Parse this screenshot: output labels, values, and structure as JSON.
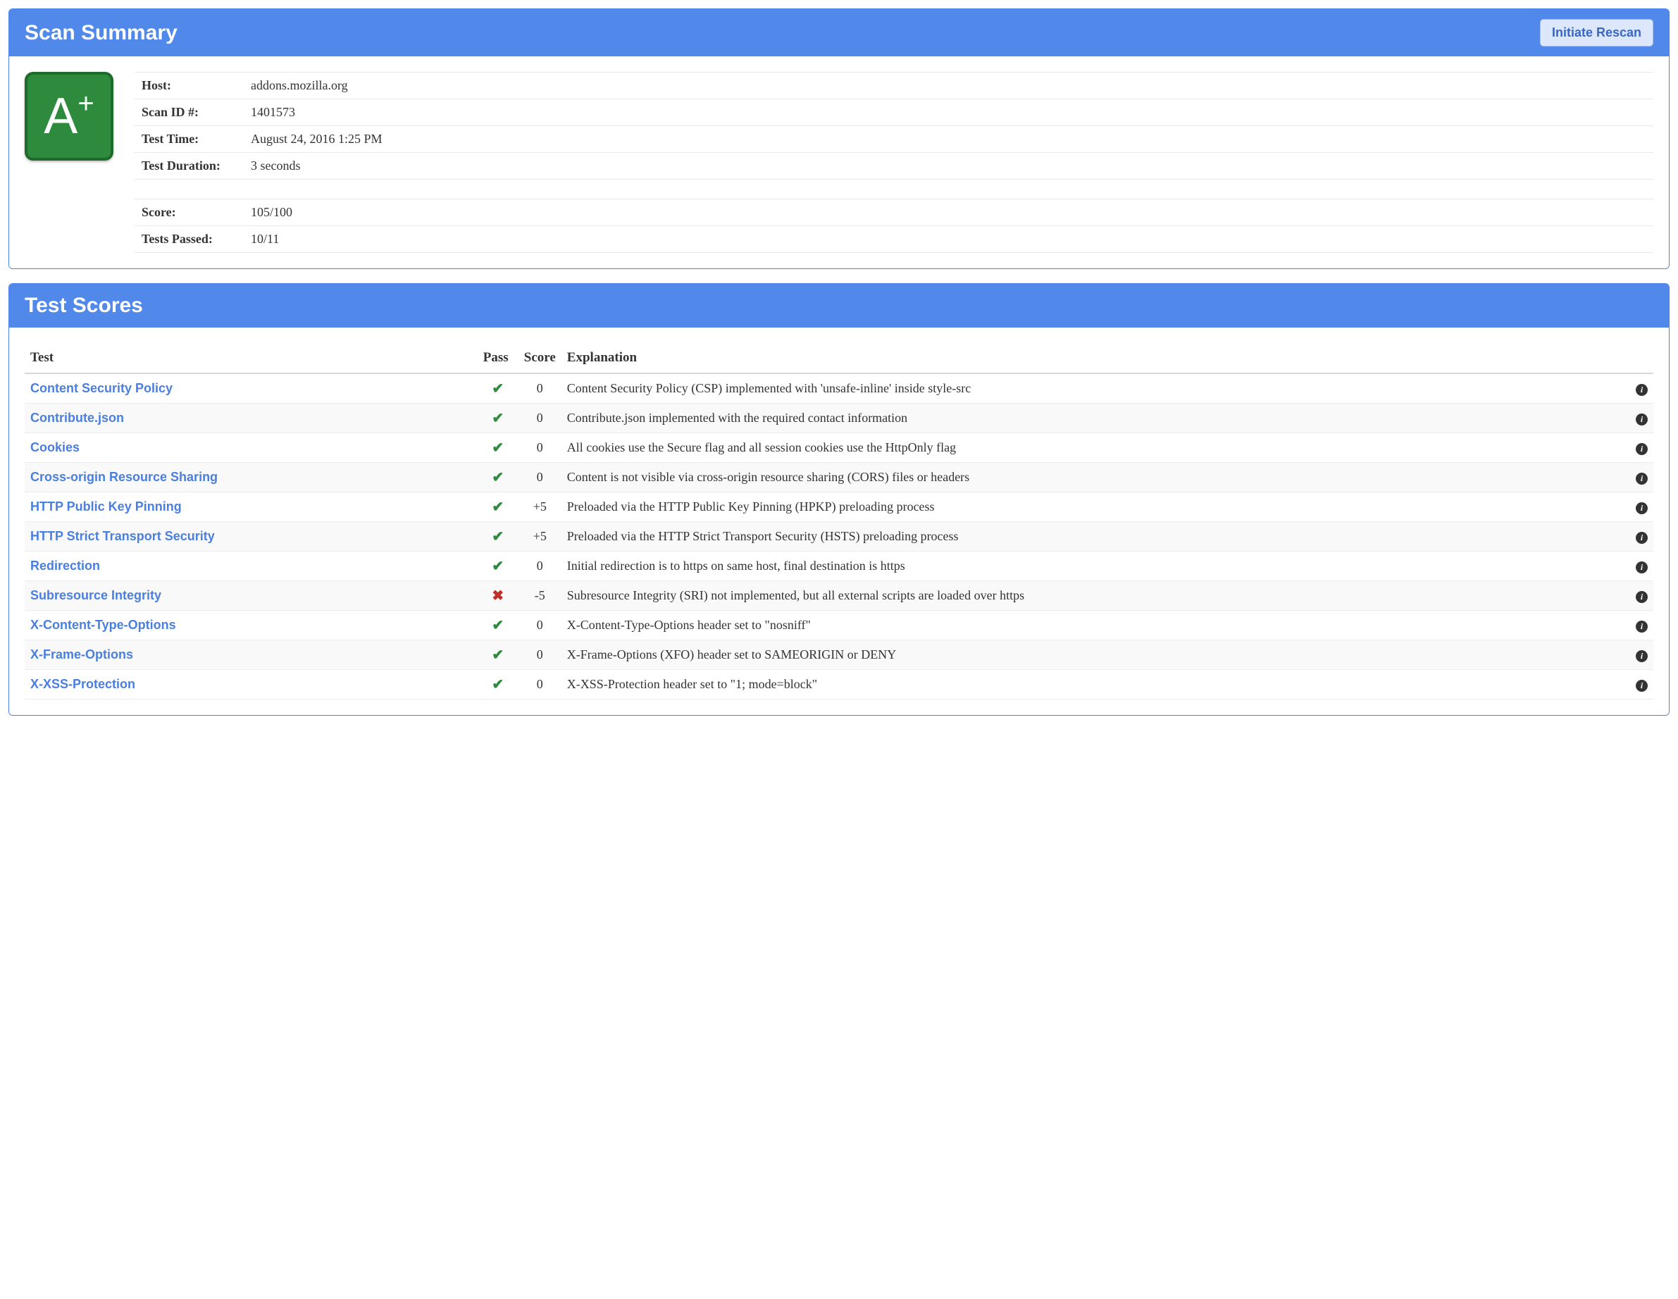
{
  "summary": {
    "panel_title": "Scan Summary",
    "rescan_label": "Initiate Rescan",
    "grade_letter": "A",
    "grade_suffix": "+",
    "labels": {
      "host": "Host:",
      "scan_id": "Scan ID #:",
      "test_time": "Test Time:",
      "test_duration": "Test Duration:",
      "score": "Score:",
      "tests_passed": "Tests Passed:"
    },
    "values": {
      "host": "addons.mozilla.org",
      "scan_id": "1401573",
      "test_time": "August 24, 2016 1:25 PM",
      "test_duration": "3 seconds",
      "score": "105/100",
      "tests_passed": "10/11"
    }
  },
  "scores": {
    "panel_title": "Test Scores",
    "columns": {
      "test": "Test",
      "pass": "Pass",
      "score": "Score",
      "explanation": "Explanation"
    },
    "rows": [
      {
        "test": "Content Security Policy",
        "pass": true,
        "score": "0",
        "explanation": "Content Security Policy (CSP) implemented with 'unsafe-inline' inside style-src"
      },
      {
        "test": "Contribute.json",
        "pass": true,
        "score": "0",
        "explanation": "Contribute.json implemented with the required contact information"
      },
      {
        "test": "Cookies",
        "pass": true,
        "score": "0",
        "explanation": "All cookies use the Secure flag and all session cookies use the HttpOnly flag"
      },
      {
        "test": "Cross-origin Resource Sharing",
        "pass": true,
        "score": "0",
        "explanation": "Content is not visible via cross-origin resource sharing (CORS) files or headers"
      },
      {
        "test": "HTTP Public Key Pinning",
        "pass": true,
        "score": "+5",
        "explanation": "Preloaded via the HTTP Public Key Pinning (HPKP) preloading process"
      },
      {
        "test": "HTTP Strict Transport Security",
        "pass": true,
        "score": "+5",
        "explanation": "Preloaded via the HTTP Strict Transport Security (HSTS) preloading process"
      },
      {
        "test": "Redirection",
        "pass": true,
        "score": "0",
        "explanation": "Initial redirection is to https on same host, final destination is https"
      },
      {
        "test": "Subresource Integrity",
        "pass": false,
        "score": "-5",
        "explanation": "Subresource Integrity (SRI) not implemented, but all external scripts are loaded over https"
      },
      {
        "test": "X-Content-Type-Options",
        "pass": true,
        "score": "0",
        "explanation": "X-Content-Type-Options header set to \"nosniff\""
      },
      {
        "test": "X-Frame-Options",
        "pass": true,
        "score": "0",
        "explanation": "X-Frame-Options (XFO) header set to SAMEORIGIN or DENY"
      },
      {
        "test": "X-XSS-Protection",
        "pass": true,
        "score": "0",
        "explanation": "X-XSS-Protection header set to \"1; mode=block\""
      }
    ]
  }
}
